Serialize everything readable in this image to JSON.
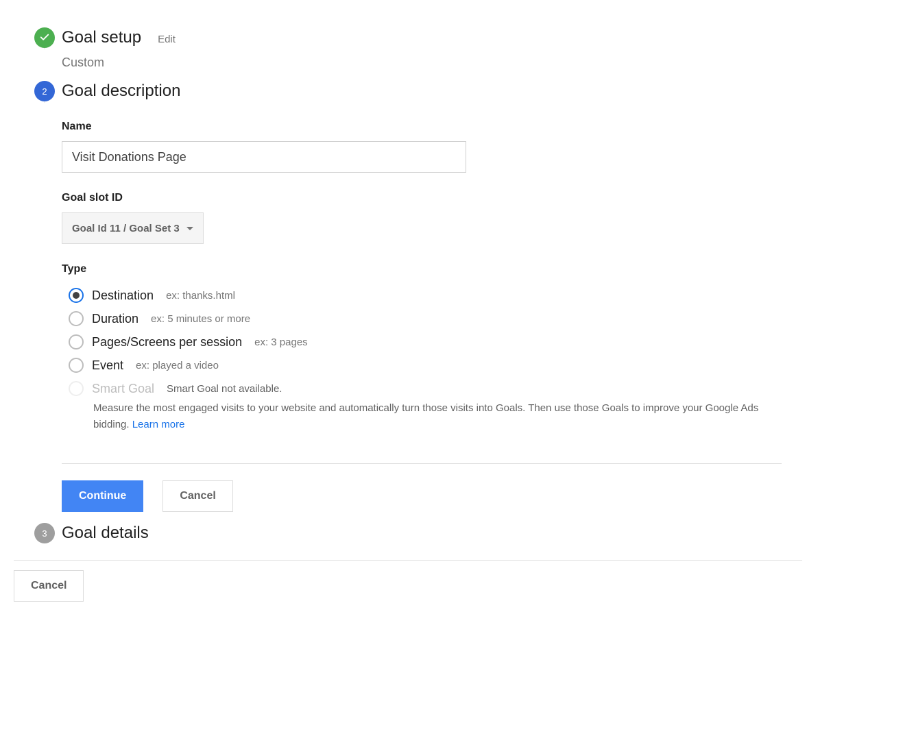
{
  "steps": {
    "setup": {
      "title": "Goal setup",
      "edit": "Edit",
      "subtitle": "Custom"
    },
    "description": {
      "number": "2",
      "title": "Goal description",
      "name_label": "Name",
      "name_value": "Visit Donations Page",
      "slot_label": "Goal slot ID",
      "slot_value": "Goal Id 11 / Goal Set 3",
      "type_label": "Type",
      "type_options": [
        {
          "label": "Destination",
          "example": "ex: thanks.html",
          "selected": true,
          "disabled": false
        },
        {
          "label": "Duration",
          "example": "ex: 5 minutes or more",
          "selected": false,
          "disabled": false
        },
        {
          "label": "Pages/Screens per session",
          "example": "ex: 3 pages",
          "selected": false,
          "disabled": false
        },
        {
          "label": "Event",
          "example": "ex: played a video",
          "selected": false,
          "disabled": false
        },
        {
          "label": "Smart Goal",
          "example": "Smart Goal not available.",
          "selected": false,
          "disabled": true,
          "description": "Measure the most engaged visits to your website and automatically turn those visits into Goals. Then use those Goals to improve your Google Ads bidding. ",
          "link": "Learn more"
        }
      ],
      "continue": "Continue",
      "cancel": "Cancel"
    },
    "details": {
      "number": "3",
      "title": "Goal details"
    }
  },
  "outer_cancel": "Cancel"
}
